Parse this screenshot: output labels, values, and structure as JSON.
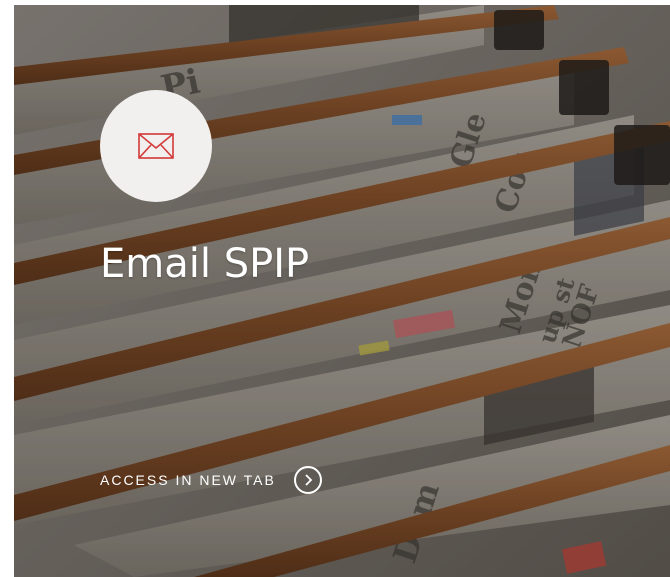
{
  "card": {
    "title": "Email SPIP",
    "link_label": "ACCESS IN NEW TAB",
    "icon": "envelope-icon",
    "link_icon": "chevron-right-circle-icon",
    "background": "newspapers-on-wooden-rack-photo"
  },
  "colors": {
    "icon_circle_bg": "#f1f0ee",
    "icon_stroke": "#d23a3a",
    "text": "#ffffff"
  }
}
